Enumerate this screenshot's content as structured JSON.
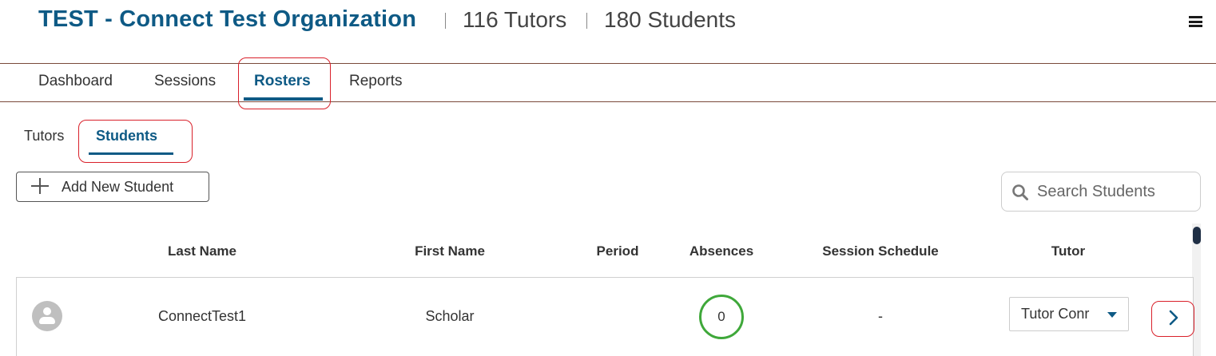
{
  "header": {
    "org_title": "TEST - Connect Test Organization",
    "tutors_count": "116 Tutors",
    "students_count": "180 Students"
  },
  "nav": {
    "tabs": [
      {
        "label": "Dashboard",
        "active": false
      },
      {
        "label": "Sessions",
        "active": false
      },
      {
        "label": "Rosters",
        "active": true
      },
      {
        "label": "Reports",
        "active": false
      }
    ]
  },
  "subnav": {
    "tabs": [
      {
        "label": "Tutors",
        "active": false
      },
      {
        "label": "Students",
        "active": true
      }
    ]
  },
  "toolbar": {
    "add_label": "Add New Student"
  },
  "search": {
    "placeholder": "Search Students",
    "value": ""
  },
  "table": {
    "columns": [
      "Last Name",
      "First Name",
      "Period",
      "Absences",
      "Session Schedule",
      "Tutor"
    ],
    "rows": [
      {
        "last_name": "ConnectTest1",
        "first_name": "Scholar",
        "period": "",
        "absences": "0",
        "session_schedule": "-",
        "tutor": "Tutor Conr"
      }
    ]
  },
  "icons": {
    "menu": "hamburger-menu-icon",
    "add": "plus-icon",
    "search": "search-icon",
    "avatar": "user-avatar-icon",
    "dropdown": "caret-down-icon",
    "row_action": "chevron-right-icon"
  },
  "colors": {
    "brand": "#0e5a85",
    "highlight": "#d9202a",
    "absence_ok": "#3fa83a"
  }
}
